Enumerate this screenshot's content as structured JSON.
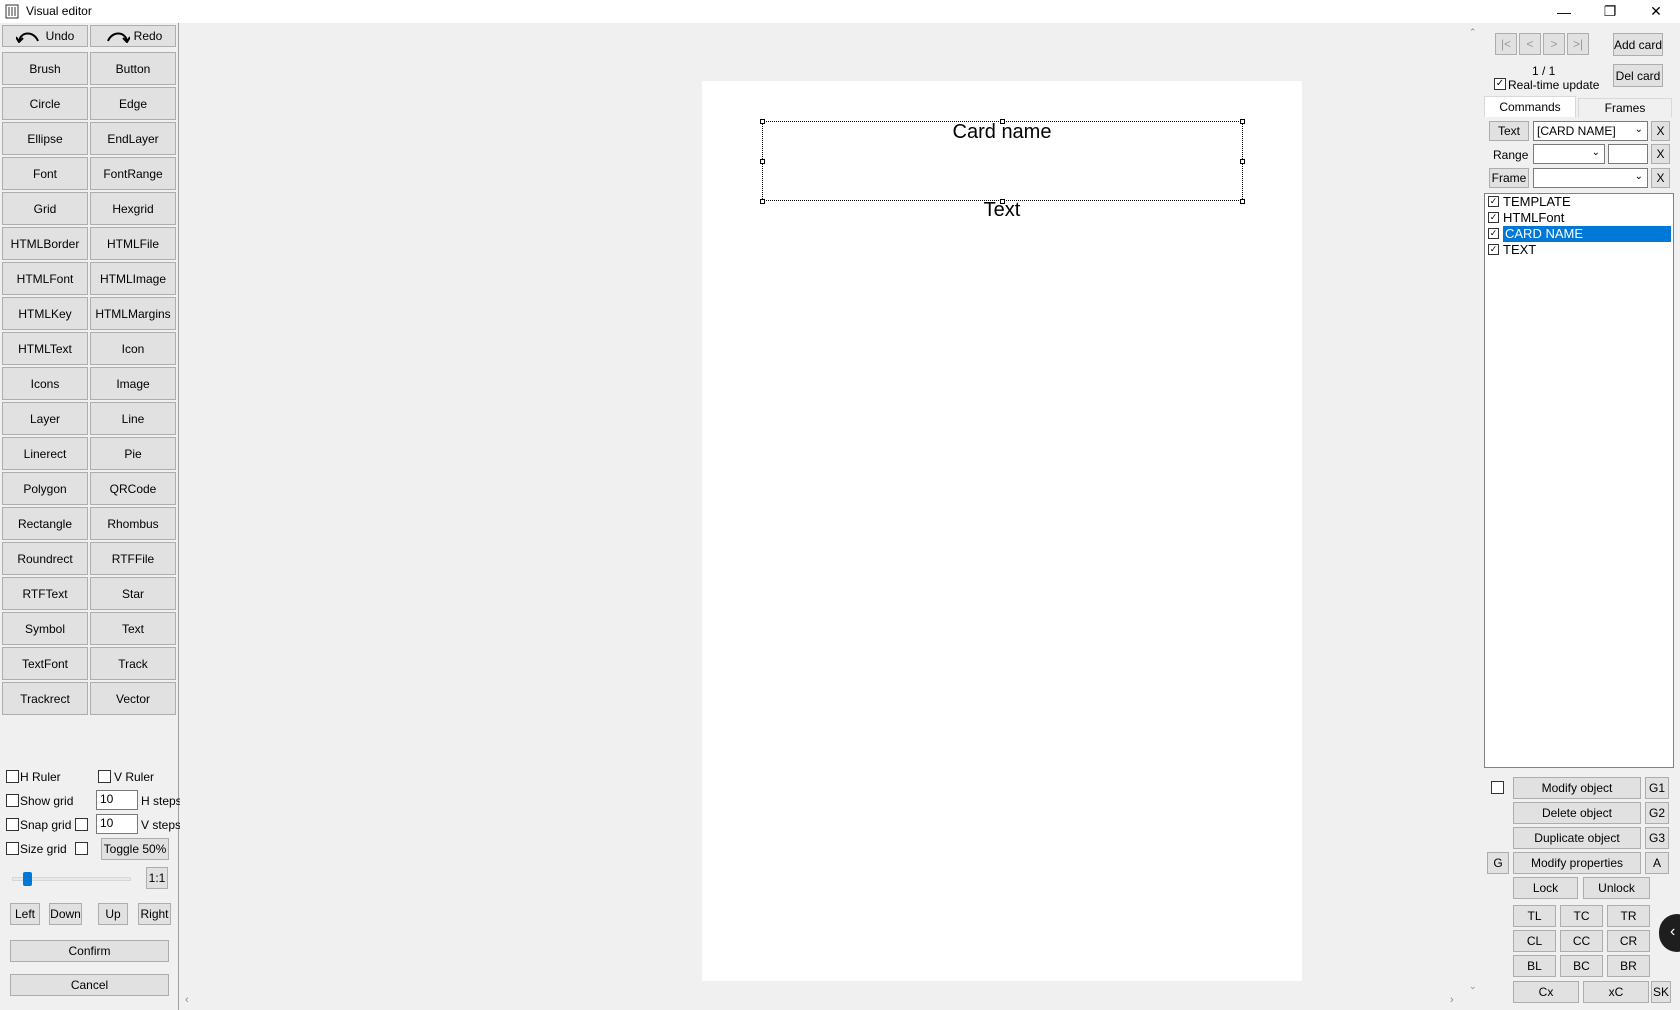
{
  "window": {
    "title": "Visual editor"
  },
  "toolbar": {
    "undo_label": "Undo",
    "redo_label": "Redo"
  },
  "tools": [
    "Brush",
    "Button",
    "Circle",
    "Edge",
    "Ellipse",
    "EndLayer",
    "Font",
    "FontRange",
    "Grid",
    "Hexgrid",
    "HTMLBorder",
    "HTMLFile",
    "HTMLFont",
    "HTMLImage",
    "HTMLKey",
    "HTMLMargins",
    "HTMLText",
    "Icon",
    "Icons",
    "Image",
    "Layer",
    "Line",
    "Linerect",
    "Pie",
    "Polygon",
    "QRCode",
    "Rectangle",
    "Rhombus",
    "Roundrect",
    "RTFFile",
    "RTFText",
    "Star",
    "Symbol",
    "Text",
    "TextFont",
    "Track",
    "Trackrect",
    "Vector"
  ],
  "options": {
    "h_ruler": "H Ruler",
    "v_ruler": "V Ruler",
    "show_grid": "Show grid",
    "snap_grid": "Snap grid",
    "size_grid": "Size grid",
    "h_steps_value": "10",
    "v_steps_value": "10",
    "h_steps_label": "H steps",
    "v_steps_label": "V steps",
    "toggle_50": "Toggle 50%",
    "ratio": "1:1",
    "zoom_slider_value": 0.1
  },
  "nav_buttons": {
    "left": "Left",
    "down": "Down",
    "up": "Up",
    "right": "Right"
  },
  "actions": {
    "confirm": "Confirm",
    "cancel": "Cancel"
  },
  "canvas": {
    "card_name_text": "Card name",
    "text_text": "Text"
  },
  "right": {
    "nav_first": "|<",
    "nav_prev": "<",
    "nav_next": ">",
    "nav_last": ">|",
    "page_counter": "1 / 1",
    "realtime_label": "Real-time update",
    "add_card": "Add card",
    "del_card": "Del card",
    "tab_commands": "Commands",
    "tab_frames": "Frames",
    "text_button": "Text",
    "text_combo_value": "[CARD NAME]",
    "range_label": "Range",
    "frame_button": "Frame",
    "x_label": "X",
    "objects": [
      {
        "label": "TEMPLATE",
        "checked": true,
        "selected": false
      },
      {
        "label": "HTMLFont",
        "checked": true,
        "selected": false
      },
      {
        "label": "CARD NAME",
        "checked": true,
        "selected": true
      },
      {
        "label": "TEXT",
        "checked": true,
        "selected": false
      }
    ],
    "modify_object": "Modify object",
    "delete_object": "Delete object",
    "duplicate_object": "Duplicate object",
    "modify_properties": "Modify properties",
    "g1": "G1",
    "g2": "G2",
    "g3": "G3",
    "g": "G",
    "a": "A",
    "lock": "Lock",
    "unlock": "Unlock",
    "align": [
      "TL",
      "TC",
      "TR",
      "CL",
      "CC",
      "CR",
      "BL",
      "BC",
      "BR"
    ],
    "cx": "Cx",
    "xc": "xC",
    "sk": "SK"
  }
}
